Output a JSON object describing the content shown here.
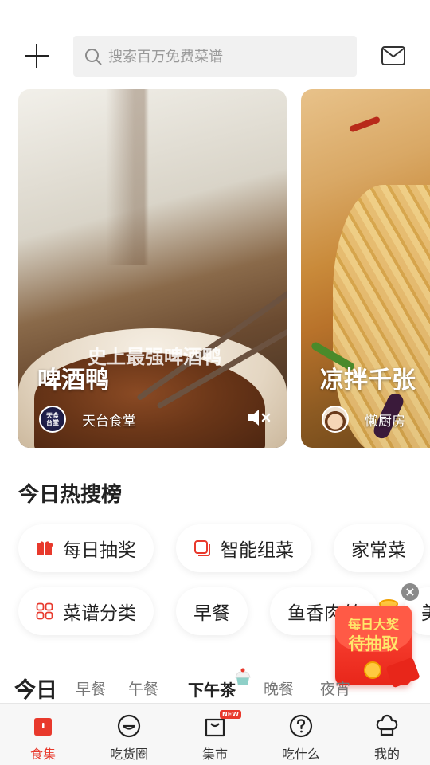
{
  "header": {
    "search_placeholder": "搜索百万免费菜谱"
  },
  "carousel": [
    {
      "title": "啤酒鸭",
      "subtitle": "史上最强啤酒鸭",
      "author": "天台食堂",
      "avatar_text": "天食台堂"
    },
    {
      "title": "凉拌千张",
      "author": "懒厨房"
    }
  ],
  "hot_search": {
    "title": "今日热搜榜",
    "row1": [
      "每日抽奖",
      "智能组菜",
      "家常菜"
    ],
    "row2": [
      "菜谱分类",
      "早餐",
      "鱼香肉丝",
      "美"
    ]
  },
  "red_packet": {
    "line1": "每日大奖",
    "line2": "待抽取",
    "close": "×"
  },
  "day_tabs": [
    "今日",
    "早餐",
    "午餐",
    "下午茶",
    "晚餐",
    "夜宵"
  ],
  "bottom_nav": [
    {
      "label": "食集",
      "icon": "home-icon",
      "active": true
    },
    {
      "label": "吃货圈",
      "icon": "smile-face-icon"
    },
    {
      "label": "集市",
      "icon": "shopping-bag-icon",
      "badge": "NEW"
    },
    {
      "label": "吃什么",
      "icon": "question-icon"
    },
    {
      "label": "我的",
      "icon": "chef-hat-icon"
    }
  ],
  "colors": {
    "accent": "#e8392c",
    "search_bg": "#f1f1f1"
  }
}
